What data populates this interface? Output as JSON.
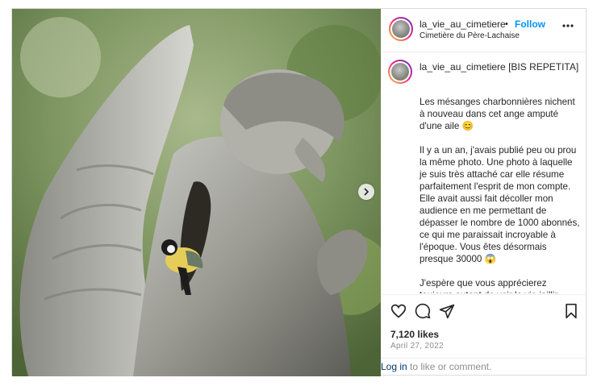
{
  "post": {
    "username": "la_vie_au_cimetiere",
    "separator": "•",
    "follow_label": "Follow",
    "location": "Cimetière du Père-Lachaise",
    "more_icon": "more-horizontal-icon",
    "caption_head": "[BIS REPETITA]",
    "caption_paragraphs": [
      "Les mésanges charbonnières nichent à nouveau dans cet ange amputé d'une aile 😊",
      "Il y a un an, j'avais publié peu ou prou la même photo. Une photo à laquelle je suis très attaché car elle résume parfaitement l'esprit de mon compte. Elle avait aussi fait décoller mon audience en me permettant de dépasser le nombre de 1000 abonnés, ce qui me paraissait incroyable à l'époque. Vous êtes désormais presque 30000 😱",
      "J'espère que vous apprécierez toujours autant de voir la vie jaillir d'une tombe 🙌"
    ],
    "likes": "7,120 likes",
    "date": "April 27, 2022",
    "login_link": "Log in",
    "login_rest": " to like or comment."
  },
  "icons": {
    "like": "heart-icon",
    "comment": "comment-icon",
    "share": "send-icon",
    "save": "bookmark-icon",
    "next": "chevron-right-icon"
  },
  "colors": {
    "accent": "#0095f6",
    "link": "#00376b",
    "muted": "#8e8e8e",
    "border": "#dbdbdb"
  }
}
